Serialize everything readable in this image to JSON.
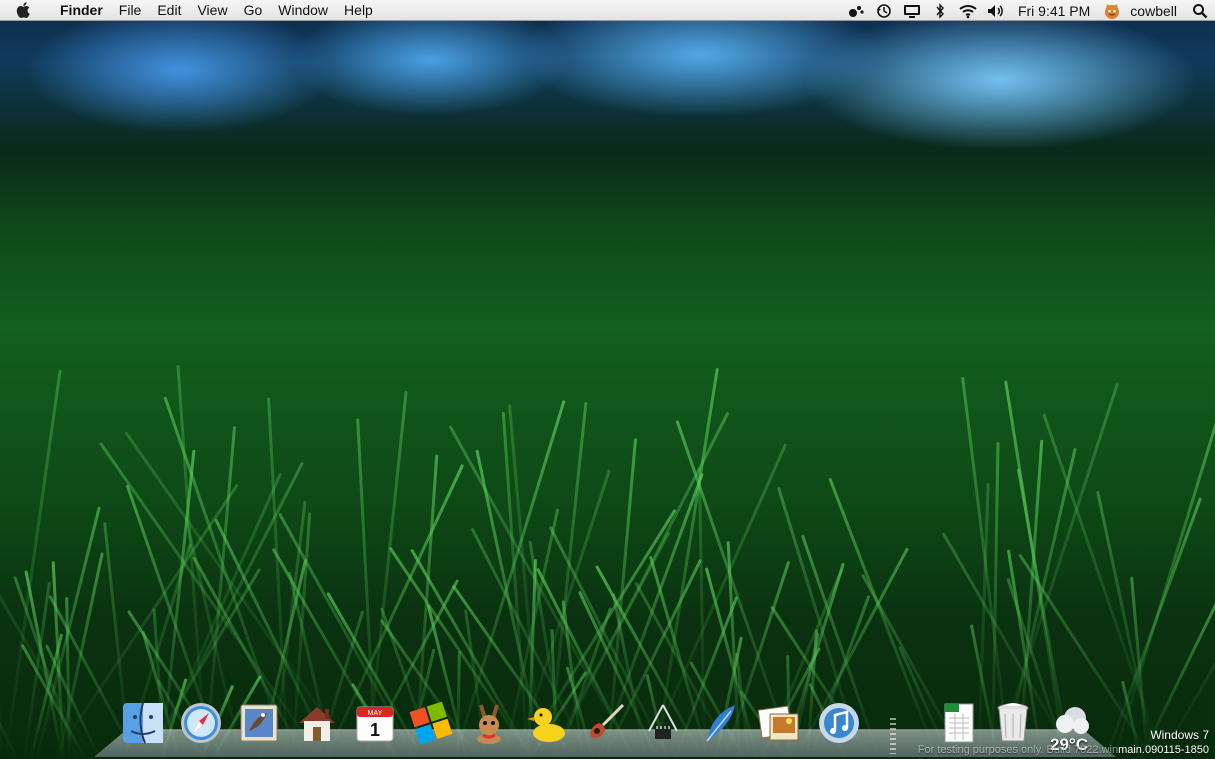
{
  "menubar": {
    "items": [
      "Finder",
      "File",
      "Edit",
      "View",
      "Go",
      "Window",
      "Help"
    ],
    "clock": "Fri 9:41 PM",
    "user": "cowbell"
  },
  "dock": {
    "apps": [
      {
        "name": "finder-icon"
      },
      {
        "name": "safari-icon"
      },
      {
        "name": "mail-icon"
      },
      {
        "name": "home-icon"
      },
      {
        "name": "ical-icon",
        "calendar_month": "MAY",
        "calendar_day": "1"
      },
      {
        "name": "windows-logo-icon"
      },
      {
        "name": "adium-icon"
      },
      {
        "name": "cyberduck-icon"
      },
      {
        "name": "garageband-icon"
      },
      {
        "name": "system-profiler-icon"
      },
      {
        "name": "quill-icon"
      },
      {
        "name": "iphoto-icon"
      },
      {
        "name": "itunes-icon"
      },
      {
        "name": "documents-stack-icon"
      },
      {
        "name": "trash-icon"
      },
      {
        "name": "weather-widget-icon"
      }
    ],
    "weather_temp": "29°C"
  },
  "watermark": {
    "title": "Windows 7",
    "build_dim": "For testing purposes only. Build 7022.win",
    "build_main": "main.090115-1850"
  }
}
